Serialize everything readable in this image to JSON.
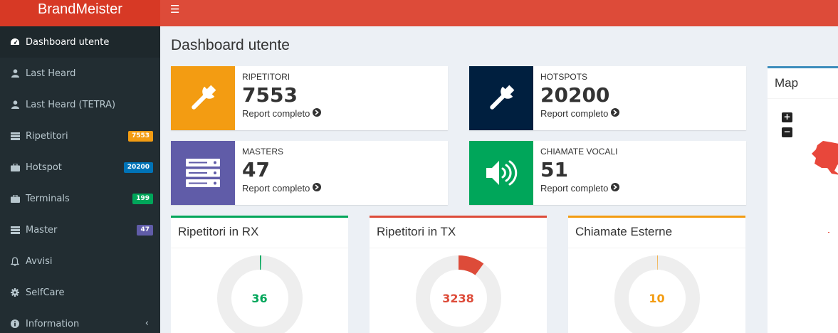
{
  "brand": {
    "title": "BrandMeister"
  },
  "sidebar": {
    "items": [
      {
        "label": "Dashboard utente",
        "icon": "dashboard-icon"
      },
      {
        "label": "Last Heard",
        "icon": "user-icon"
      },
      {
        "label": "Last Heard (TETRA)",
        "icon": "user-icon"
      },
      {
        "label": "Ripetitori",
        "icon": "server-icon",
        "badge": "7553",
        "badge_color": "#f39c12"
      },
      {
        "label": "Hotspot",
        "icon": "briefcase-icon",
        "badge": "20200",
        "badge_color": "#0073b7"
      },
      {
        "label": "Terminals",
        "icon": "briefcase-icon",
        "badge": "199",
        "badge_color": "#00a65a"
      },
      {
        "label": "Master",
        "icon": "server-icon",
        "badge": "47",
        "badge_color": "#605ca8"
      },
      {
        "label": "Avvisi",
        "icon": "bell-icon"
      },
      {
        "label": "SelfCare",
        "icon": "gear-icon"
      },
      {
        "label": "Information",
        "icon": "info-icon"
      }
    ]
  },
  "page": {
    "title": "Dashboard utente"
  },
  "info_boxes": [
    {
      "caption": "RIPETITORI",
      "value": "7553",
      "link": "Report completo",
      "color": "#f39c12",
      "icon": "wrench-icon"
    },
    {
      "caption": "HOTSPOTS",
      "value": "20200",
      "link": "Report completo",
      "color": "#001f3f",
      "icon": "wrench-icon"
    },
    {
      "caption": "MASTERS",
      "value": "47",
      "link": "Report completo",
      "color": "#605ca8",
      "icon": "server-icon"
    },
    {
      "caption": "CHIAMATE VOCALI",
      "value": "51",
      "link": "Report completo",
      "color": "#00a65a",
      "icon": "volume-icon"
    }
  ],
  "panels": [
    {
      "title": "Ripetitori in RX",
      "value": "36",
      "color": "#00a65a",
      "fraction": 0.005
    },
    {
      "title": "Ripetitori in TX",
      "value": "3238",
      "color": "#dd4b39",
      "fraction": 0.1
    },
    {
      "title": "Chiamate Esterne",
      "value": "10",
      "color": "#f39c12",
      "fraction": 0.001
    }
  ],
  "map": {
    "title": "Map",
    "zoom_in": "+",
    "zoom_out": "−"
  }
}
